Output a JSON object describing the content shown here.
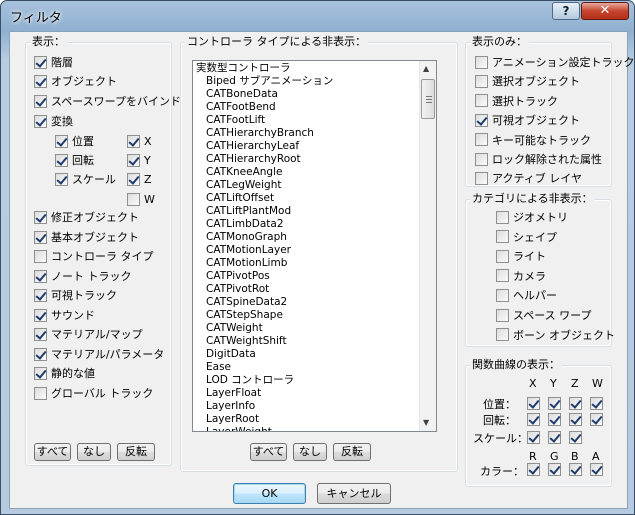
{
  "window": {
    "title": "フィルタ",
    "help_label": "?",
    "close_label": "✕"
  },
  "show": {
    "legend": "表示：",
    "items": [
      {
        "label": "階層",
        "checked": true
      },
      {
        "label": "オブジェクト",
        "checked": true
      },
      {
        "label": "スペースワープをバインド",
        "checked": true
      },
      {
        "label": "変換",
        "checked": true
      },
      {
        "label": "位置",
        "checked": true
      },
      {
        "label": "回転",
        "checked": true
      },
      {
        "label": "スケール",
        "checked": true
      },
      {
        "label": "X",
        "checked": true
      },
      {
        "label": "Y",
        "checked": true
      },
      {
        "label": "Z",
        "checked": true
      },
      {
        "label": "W",
        "checked": false
      },
      {
        "label": "修正オブジェクト",
        "checked": true
      },
      {
        "label": "基本オブジェクト",
        "checked": true
      },
      {
        "label": "コントローラ タイプ",
        "checked": false
      },
      {
        "label": "ノート トラック",
        "checked": true
      },
      {
        "label": "可視トラック",
        "checked": true
      },
      {
        "label": "サウンド",
        "checked": true
      },
      {
        "label": "マテリアル/マップ",
        "checked": true
      },
      {
        "label": "マテリアル/パラメータ",
        "checked": true
      },
      {
        "label": "静的な値",
        "checked": true
      },
      {
        "label": "グローバル トラック",
        "checked": false
      }
    ],
    "buttons": [
      "すべて",
      "なし",
      "反転"
    ]
  },
  "controllers": {
    "legend": "コントローラ タイプによる非表示：",
    "items": [
      "実数型コントローラ",
      "Biped サブアニメーション",
      "CATBoneData",
      "CATFootBend",
      "CATFootLift",
      "CATHierarchyBranch",
      "CATHierarchyLeaf",
      "CATHierarchyRoot",
      "CATKneeAngle",
      "CATLegWeight",
      "CATLiftOffset",
      "CATLiftPlantMod",
      "CATLimbData2",
      "CATMonoGraph",
      "CATMotionLayer",
      "CATMotionLimb",
      "CATPivotPos",
      "CATPivotRot",
      "CATSpineData2",
      "CATStepShape",
      "CATWeight",
      "CATWeightShift",
      "DigitData",
      "Ease",
      "LOD コントローラ",
      "LayerFloat",
      "LayerInfo",
      "LayerRoot",
      "LayerWeight"
    ],
    "buttons": [
      "すべて",
      "なし",
      "反転"
    ],
    "scroll_up": "▲",
    "scroll_down": "▼"
  },
  "show_only": {
    "legend": "表示のみ：",
    "items": [
      {
        "label": "アニメーション設定トラック",
        "checked": false
      },
      {
        "label": "選択オブジェクト",
        "checked": false
      },
      {
        "label": "選択トラック",
        "checked": false
      },
      {
        "label": "可視オブジェクト",
        "checked": true
      },
      {
        "label": "キー可能なトラック",
        "checked": false
      },
      {
        "label": "ロック解除された属性",
        "checked": false
      },
      {
        "label": "アクティブ レイヤ",
        "checked": false
      }
    ]
  },
  "category_hide": {
    "legend": "カテゴリによる非表示：",
    "items": [
      {
        "label": "ジオメトリ",
        "checked": false
      },
      {
        "label": "シェイプ",
        "checked": false
      },
      {
        "label": "ライト",
        "checked": false
      },
      {
        "label": "カメラ",
        "checked": false
      },
      {
        "label": "ヘルパー",
        "checked": false
      },
      {
        "label": "スペース ワープ",
        "checked": false
      },
      {
        "label": "ボーン オブジェクト",
        "checked": false
      }
    ]
  },
  "function_curves": {
    "legend": "関数曲線の表示：",
    "col_headers": [
      "X",
      "Y",
      "Z",
      "W"
    ],
    "rows": [
      {
        "label": "位置：",
        "checks": [
          true,
          true,
          true,
          true
        ]
      },
      {
        "label": "回転：",
        "checks": [
          true,
          true,
          true,
          true
        ]
      },
      {
        "label": "スケール：",
        "checks": [
          true,
          true,
          true
        ]
      }
    ],
    "color_headers": [
      "R",
      "G",
      "B",
      "A"
    ],
    "color_row": {
      "label": "カラー：",
      "checks": [
        true,
        true,
        true,
        true
      ]
    }
  },
  "footer": {
    "ok": "OK",
    "cancel": "キャンセル"
  }
}
